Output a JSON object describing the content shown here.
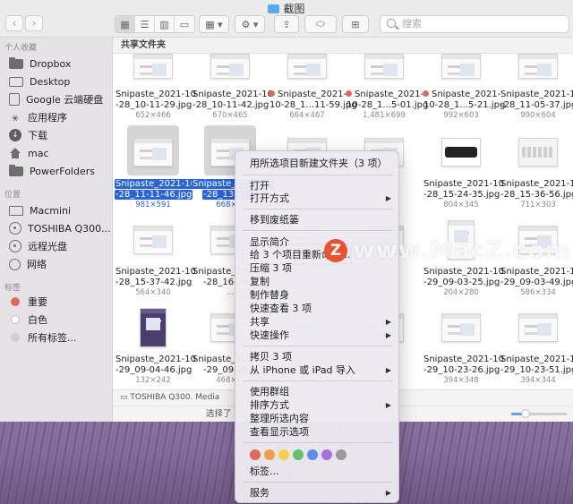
{
  "window": {
    "title": "截图",
    "search_placeholder": "搜索"
  },
  "sidebar": {
    "favorites_header": "个人收藏",
    "favorites": [
      {
        "label": "Dropbox",
        "icon": "folder-icon"
      },
      {
        "label": "Desktop",
        "icon": "desktop-icon"
      },
      {
        "label": "Google 云端硬盘",
        "icon": "document-icon"
      },
      {
        "label": "应用程序",
        "icon": "applications-icon"
      },
      {
        "label": "下载",
        "icon": "download-icon"
      },
      {
        "label": "mac",
        "icon": "home-icon"
      },
      {
        "label": "PowerFolders",
        "icon": "folder-icon"
      }
    ],
    "locations_header": "位置",
    "locations": [
      {
        "label": "Macmini",
        "icon": "computer-icon"
      },
      {
        "label": "TOSHIBA Q300...",
        "icon": "disk-icon"
      },
      {
        "label": "远程光盘",
        "icon": "optical-disk-icon"
      },
      {
        "label": "网络",
        "icon": "network-icon"
      }
    ],
    "tags_header": "标签",
    "tags": [
      {
        "label": "重要",
        "color": "#e2675a"
      },
      {
        "label": "白色",
        "color": "#ffffff"
      },
      {
        "label": "所有标签...",
        "color": "#cfcfcf"
      }
    ]
  },
  "content": {
    "header": "共享文件夹",
    "files": [
      {
        "name1": "Snipaste_2021-10",
        "name2": "-28_10-11-29.jpg",
        "size": "652×466",
        "selected": false,
        "tag": false
      },
      {
        "name1": "Snipaste_2021-10",
        "name2": "-28_10-11-42.jpg",
        "size": "670×465",
        "selected": false,
        "tag": false
      },
      {
        "name1": "Snipaste_2021-",
        "name2": "10-28_1...11-59.jpg",
        "size": "664×467",
        "selected": false,
        "tag": true
      },
      {
        "name1": "Snipaste_2021-",
        "name2": "10-28_1...5-01.jpg",
        "size": "1,481×699",
        "selected": false,
        "tag": true
      },
      {
        "name1": "Snipaste_2021-",
        "name2": "10-28_1...5-21.jpg",
        "size": "992×603",
        "selected": false,
        "tag": true
      },
      {
        "name1": "Snipaste_2021-10",
        "name2": "-28_11-05-37.jpg",
        "size": "990×604",
        "selected": false,
        "tag": false
      },
      {
        "name1": "Snipaste_2021-10",
        "name2": "-28_11-11-46.jpg",
        "size": "981×591",
        "selected": true,
        "tag": false
      },
      {
        "name1": "Snipaste_2021-10",
        "name2": "-28_13-42...",
        "size": "668×...",
        "selected": true,
        "tag": false
      },
      {
        "name1": "",
        "name2": "",
        "size": "",
        "selected": false,
        "tag": false
      },
      {
        "name1": "",
        "name2": "",
        "size": "",
        "selected": false,
        "tag": false
      },
      {
        "name1": "Snipaste_2021-10",
        "name2": "-28_15-24-35.jpg",
        "size": "804×345",
        "selected": false,
        "tag": false
      },
      {
        "name1": "Snipaste_2021-10",
        "name2": "-28_15-36-56.jpg",
        "size": "711×303",
        "selected": false,
        "tag": false
      },
      {
        "name1": "Snipaste_2021-10",
        "name2": "-28_15-37-42.jpg",
        "size": "564×340",
        "selected": false,
        "tag": false
      },
      {
        "name1": "Snipaste_2021-10",
        "name2": "-28_16-28...",
        "size": "...",
        "selected": false,
        "tag": false
      },
      {
        "name1": "",
        "name2": "",
        "size": "",
        "selected": false,
        "tag": false
      },
      {
        "name1": "",
        "name2": "",
        "size": "",
        "selected": false,
        "tag": false
      },
      {
        "name1": "Snipaste_2021-10",
        "name2": "-29_09-03-25.jpg",
        "size": "204×280",
        "selected": false,
        "tag": false
      },
      {
        "name1": "Snipaste_2021-10",
        "name2": "-29_09-03-49.jpg",
        "size": "586×334",
        "selected": false,
        "tag": false
      },
      {
        "name1": "Snipaste_2021-10",
        "name2": "-29_09-04-46.jpg",
        "size": "132×242",
        "selected": false,
        "tag": false
      },
      {
        "name1": "Snipaste_2021-10",
        "name2": "-29_09-05...",
        "size": "468×...",
        "selected": false,
        "tag": false
      },
      {
        "name1": "",
        "name2": "",
        "size": "",
        "selected": false,
        "tag": false
      },
      {
        "name1": "",
        "name2": "",
        "size": "",
        "selected": false,
        "tag": false
      },
      {
        "name1": "Snipaste_2021-10",
        "name2": "-29_10-23-26.jpg",
        "size": "394×348",
        "selected": false,
        "tag": false
      },
      {
        "name1": "Snipaste_2021-10",
        "name2": "-29_10-23-51.jpg",
        "size": "394×344",
        "selected": false,
        "tag": false
      }
    ],
    "path": "TOSHIBA Q300. Media",
    "status": "选择了"
  },
  "zoom_slider": {
    "value": 0.25
  },
  "context_menu": {
    "items": [
      {
        "label": "用所选项目新建文件夹（3 项）",
        "submenu": false
      },
      {
        "label": "打开",
        "submenu": false
      },
      {
        "label": "打开方式",
        "submenu": true
      },
      {
        "label": "移到废纸篓",
        "submenu": false
      },
      {
        "label": "显示简介",
        "submenu": false
      },
      {
        "label": "给 3 个项目重新命名...",
        "submenu": false
      },
      {
        "label": "压缩 3 项",
        "submenu": false
      },
      {
        "label": "复制",
        "submenu": false
      },
      {
        "label": "制作替身",
        "submenu": false
      },
      {
        "label": "快速查看 3 项",
        "submenu": false
      },
      {
        "label": "共享",
        "submenu": true
      },
      {
        "label": "快速操作",
        "submenu": true
      },
      {
        "label": "拷贝 3 项",
        "submenu": false
      },
      {
        "label": "从 iPhone 或 iPad 导入",
        "submenu": true
      },
      {
        "label": "使用群组",
        "submenu": false
      },
      {
        "label": "排序方式",
        "submenu": true
      },
      {
        "label": "整理所选内容",
        "submenu": false
      },
      {
        "label": "查看显示选项",
        "submenu": false
      },
      {
        "label": "标签...",
        "submenu": false
      },
      {
        "label": "服务",
        "submenu": true
      }
    ],
    "tag_colors": [
      "#e2675a",
      "#f0a048",
      "#f4d04a",
      "#62c26a",
      "#5b8fe8",
      "#a574d8",
      "#9a9a9a"
    ]
  },
  "watermark": {
    "text": "www.MacZ.com",
    "logo": "Z"
  }
}
